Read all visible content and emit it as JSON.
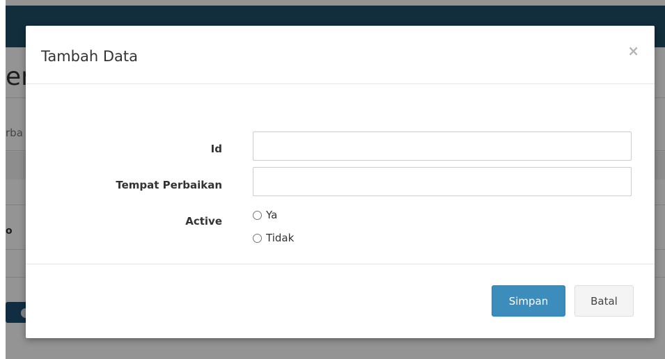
{
  "background": {
    "page_title_fragment": "erb",
    "subtext_fragment": "rba",
    "column_fragment": "o"
  },
  "modal": {
    "title": "Tambah Data",
    "close_label": "×",
    "fields": {
      "id": {
        "label": "Id",
        "value": "",
        "placeholder": ""
      },
      "tempat_perbaikan": {
        "label": "Tempat Perbaikan",
        "value": "",
        "placeholder": ""
      },
      "active": {
        "label": "Active",
        "options": [
          {
            "label": "Ya",
            "checked": false
          },
          {
            "label": "Tidak",
            "checked": false
          }
        ]
      }
    },
    "buttons": {
      "save_label": "Simpan",
      "cancel_label": "Batal"
    }
  },
  "colors": {
    "primary_button": "#3c8dbc",
    "topbar": "#1f4e67",
    "overlay": "rgba(0,0,0,0.42)"
  }
}
